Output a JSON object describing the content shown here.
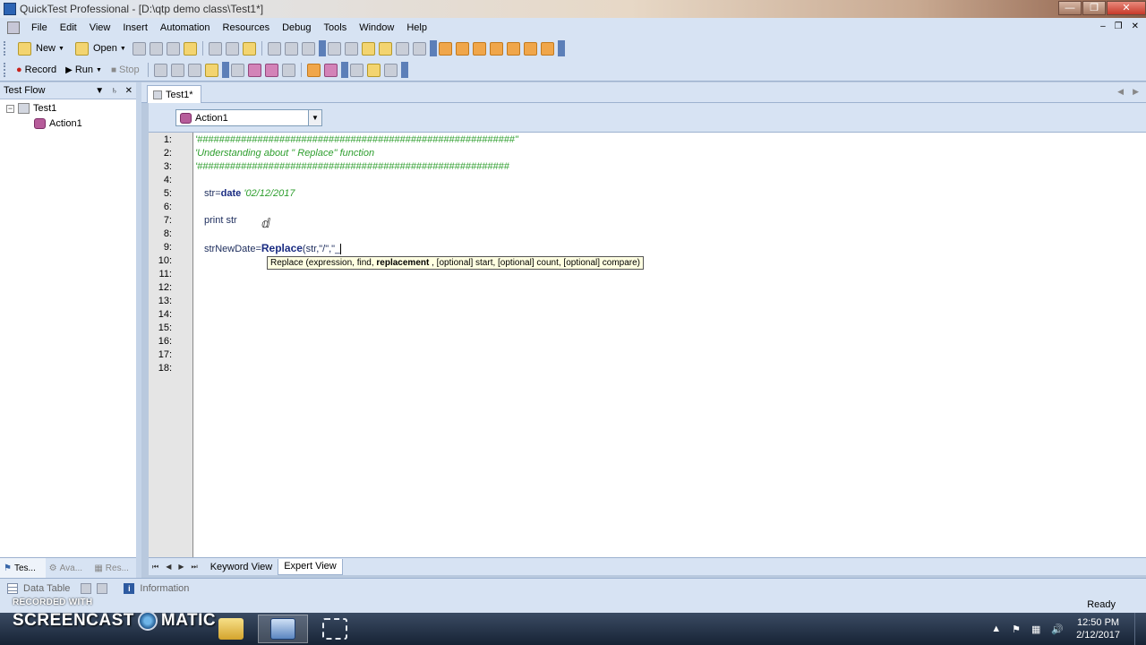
{
  "window": {
    "title": "QuickTest Professional - [D:\\qtp demo class\\Test1*]"
  },
  "menubar": {
    "items": [
      "File",
      "Edit",
      "View",
      "Insert",
      "Automation",
      "Resources",
      "Debug",
      "Tools",
      "Window",
      "Help"
    ]
  },
  "toolbar1": {
    "new_label": "New",
    "open_label": "Open"
  },
  "toolbar2": {
    "record_label": "Record",
    "run_label": "Run",
    "stop_label": "Stop"
  },
  "test_flow": {
    "title": "Test Flow",
    "tree": {
      "root": "Test1",
      "child": "Action1"
    }
  },
  "left_tabs": [
    "Tes...",
    "Ava...",
    "Res..."
  ],
  "document": {
    "tab_label": "Test1*",
    "action_selected": "Action1"
  },
  "editor": {
    "line_numbers": [
      "1:",
      "2:",
      "3:",
      "4:",
      "5:",
      "6:",
      "7:",
      "8:",
      "9:",
      "10:",
      "11:",
      "12:",
      "13:",
      "14:",
      "15:",
      "16:",
      "17:",
      "18:"
    ],
    "line1": "'##########################################################\"",
    "line2": "'Understanding about \" Replace\" function",
    "line3": "'#########################################################",
    "line5_var": "str=",
    "line5_kw": "date",
    "line5_cmt": " '02/12/2017",
    "line7": "print str",
    "line9_var": "strNewDate=",
    "line9_kw": "Replace",
    "line9_args": "(str,\"/\",\"_",
    "tooltip": {
      "prefix": "Replace (expression, find, ",
      "bold": "replacement",
      "suffix": " , [optional] start, [optional] count, [optional] compare)"
    }
  },
  "view_tabs": {
    "keyword_view": "Keyword View",
    "expert_view": "Expert View",
    "active": "Expert View"
  },
  "bottom_panes": {
    "data_table": "Data Table",
    "information": "Information"
  },
  "status": {
    "text": "Ready"
  },
  "watermark": {
    "small": "RECORDED WITH",
    "big_left": "SCREENCAST",
    "big_right": "MATIC"
  },
  "taskbar": {
    "time": "12:50 PM",
    "date": "2/12/2017"
  },
  "colors": {
    "comment": "#2e9e2e",
    "keyword": "#1a2c82",
    "chrome": "#d7e3f3"
  }
}
